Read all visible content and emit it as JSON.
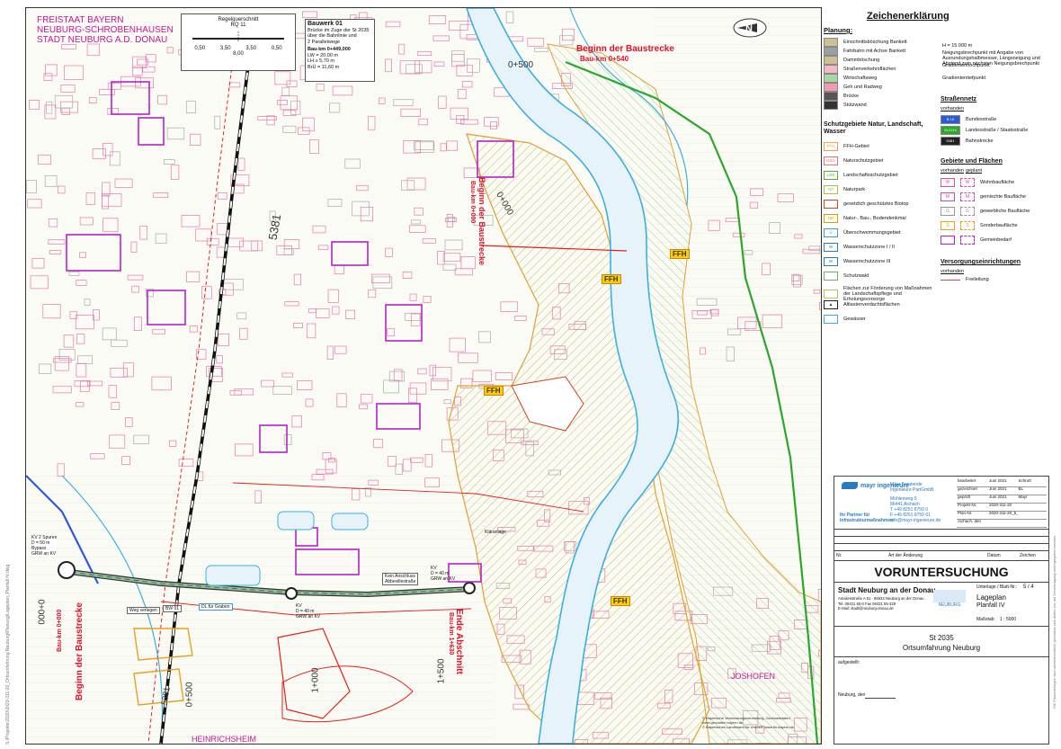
{
  "map": {
    "header_left": [
      "FREISTAAT BAYERN",
      "NEUBURG-SCHROBENHAUSEN",
      "STADT NEUBURG A.D. DONAU"
    ],
    "regelquerschnitt": {
      "title": "Regelquerschnitt",
      "subtitle": "RQ 11",
      "dims": [
        "0,50",
        "3,50",
        "3,50",
        "0,50"
      ],
      "total": "8,00"
    },
    "bauwerk": {
      "title": "Bauwerk 01",
      "desc": [
        "Brücke im Zuge der St 2035",
        "über die Bahnlinie und",
        "2 Parallelwege"
      ],
      "km": "Bau-km 0+449,000",
      "rows": [
        "LW =   20,00 m",
        "LH  ≥    5,70 m",
        "BrÜ =   11,60 m"
      ]
    },
    "labels": {
      "beginn_top": "Beginn der Baustrecke",
      "beginn_top_km": "Bau-km 0+540",
      "km_0500_top": "0+500",
      "beginn_mid": "Beginn der Baustrecke",
      "beginn_mid_km": "Bau-km 0+000",
      "km_0000_mid": "0+000",
      "road_5381": "5381",
      "road_5381_b": "5381",
      "beginn_bottom": "Beginn der Baustrecke",
      "beginn_bottom_km": "Bau-km 0+000",
      "km_0000_left": "0+000",
      "ende": "Ende Abschnitt",
      "ende_km": "Bau-km 1+630",
      "km_0500_bottom": "0+500",
      "km_1000": "1+000",
      "km_1500": "1+500",
      "ffh": [
        "FFH",
        "FFH",
        "FFH",
        "FFH"
      ],
      "joshofen": "JOSHOFEN",
      "heinrichsheim": "HEINRICHSHEIM",
      "kreisel_left": [
        "KV 2 Spuren",
        "D = 50 m",
        "Bypass",
        "GRW an KV"
      ],
      "kreisel_mid": [
        "KV",
        "D = 40 m",
        "GRW an KV"
      ],
      "kreisel_right": [
        "KV",
        "D = 40 m",
        "GRW an KV"
      ],
      "kein_anschluss": [
        "Kein Anschluss",
        "Abbevillestraße"
      ],
      "weg_verlegen": "Weg verlegen",
      "dl_graben": "DL für Graben",
      "bw01": "BW 01",
      "klaeranlage": "Kläranlage",
      "copyright": [
        "© Bayerische Vermessungsverwaltung, Geobasisdaten",
        "www.geodaten.bayern.de",
        "© Bayerisches Landesamt für Umwelt, www.lfu.bayern.de"
      ]
    }
  },
  "legend": {
    "title": "Zeichenerklärung",
    "planung": "Planung:",
    "planung_items": [
      "Einschnittsböschung Bankett",
      "Fahrbahn mit Achse Bankett",
      "Dammböschung",
      "Straßenverkehrsflächen",
      "Wirtschaftsweg",
      "Geh und Radweg",
      "Brücke",
      "Stützwand"
    ],
    "neigung_items": [
      "Neigungsbrechpunkt mit Angabe von Ausrundungshalbmesser, Längsneigung und Abstand zum nächsten Neigungsbrechpunkt",
      "Gradientenhochpunkt",
      "Gradiententiefpunkt"
    ],
    "neigung_h": "H = 15.000 m",
    "schutz_title": "Schutzgebiete Natur, Landschaft, Wasser",
    "schutz_items": [
      {
        "sym": "FFH",
        "label": "FFH-Gebiet",
        "color": "#f2a24a"
      },
      {
        "sym": "NSG",
        "label": "Naturschutzgebiet",
        "color": "#e8707a"
      },
      {
        "sym": "LSG",
        "label": "Landschaftsschutzgebiet",
        "color": "#58a83a"
      },
      {
        "sym": "NP",
        "label": "Naturpark",
        "color": "#a6c04a"
      },
      {
        "sym": "",
        "label": "gesetzlich geschütztes Biotop",
        "color": "#e0402a"
      },
      {
        "sym": "ND",
        "label": "Natur-, Bau-, Bodendenkmal",
        "color": "#d8a000"
      },
      {
        "sym": "Ü",
        "label": "Überschwemmungsgebiet",
        "color": "#3a9ad8"
      },
      {
        "sym": "W",
        "label": "Wasserschutzzone I / II",
        "color": "#2a7ac0"
      },
      {
        "sym": "W",
        "label": "Wasserschutzzone III",
        "color": "#2a7ac0"
      },
      {
        "sym": "",
        "label": "Schutzwald",
        "color": "#70b070"
      },
      {
        "sym": "",
        "label": "Flächen zur Förderung von Maßnahmen der Landschaftspflege und Erholungsvorsorge",
        "color": "#b8c060"
      },
      {
        "sym": "▲",
        "label": "Altlastenverdachtsflächen",
        "color": "#222222"
      },
      {
        "sym": "",
        "label": "Gewässer",
        "color": "#3ab0e0"
      }
    ],
    "strassennetz": "Straßennetz",
    "vorhanden": "vorhanden",
    "strassen_items": [
      {
        "sym": "B 16",
        "label": "Bundesstraße",
        "color": "#2a5ad8"
      },
      {
        "sym": "St 2214",
        "label": "Landesstraße / Staatsstraße",
        "color": "#2aa82a"
      },
      {
        "sym": "5381",
        "label": "Bahnstrecke",
        "color": "#222222"
      }
    ],
    "gebiete": "Gebiete und Flächen",
    "geplant": "geplant",
    "gebiete_items": [
      {
        "sym": "W",
        "label": "Wohnbaufläche",
        "color": "#e0509a"
      },
      {
        "sym": "M",
        "label": "gemischte Baufläche",
        "color": "#c8509a"
      },
      {
        "sym": "G",
        "label": "gewerbliche Baufläche",
        "color": "#a09090"
      },
      {
        "sym": "S",
        "label": "Sonderbaufläche",
        "color": "#e8a020"
      },
      {
        "sym": "",
        "label": "Gemeinbedarf",
        "color": "#b820c8"
      }
    ],
    "versorgung": "Versorgungseinrichtungen",
    "versorgung_items": [
      {
        "label": "Freileitung",
        "color": "#e04040"
      }
    ]
  },
  "titleblock": {
    "company": "mayr ingenieure",
    "company_full": "Mayr Beratende Ingenieure PartGmbB",
    "address": [
      "Mühlenweg 5",
      "86441 Aichach",
      "T +49 8251 8750 0",
      "F +49 8251 8750 01",
      "info@mayr-ingenieure.de"
    ],
    "partner": "Ihr Partner für Infrastrukturmaßnahmen",
    "meta": [
      [
        "bearbeitet",
        "Juni 2021",
        "Schrott"
      ],
      [
        "gezeichnet",
        "Juni 2021",
        "BL"
      ],
      [
        "geprüft",
        "Juni 2021",
        "Mayr"
      ],
      [
        "Projekt-Nr.",
        "2020-311-20",
        ""
      ],
      [
        "Plan-Nr.",
        "2020-311-20_5_Lageplane.dwg",
        ""
      ],
      [
        "Aichach, den",
        "",
        ""
      ]
    ],
    "change_header": [
      "Nr.",
      "Art der Änderung",
      "Datum",
      "Zeichen"
    ],
    "voruntersuchung": "VORUNTERSUCHUNG",
    "client": "Stadt Neuburg an der Donau",
    "client_addr": [
      "Amalienstraße A 51 · 86633 Neuburg an der Donau",
      "Tel. 08431 55-0 Fax 08431 55-329",
      "E-Mail: stadt@neuburg-donau.de"
    ],
    "unterlage": "Unterlage / Blatt-Nr.:",
    "unterlage_val": "5 / 4",
    "plan_type": "Lageplan",
    "plan_sub": "Planfall IV",
    "massstab": "Maßstab:",
    "massstab_val": "1 : 5000",
    "project": "St 2035",
    "project_sub": "Ortsumfahrung Neuburg",
    "aufgestellt": "aufgestellt:",
    "neuburg_den": "Neuburg, den"
  },
  "margin": {
    "left": "S:\\Projekte\\2020\\2020-311-20_Ortsumfahrung Neuburg\\Planung\\Lageplan_Planfall IV.dwg",
    "right": "Die Planunterlagen sind urheberrechtlich geschützt und dürfen nur mit Genehmigung weitergegeben werden."
  }
}
